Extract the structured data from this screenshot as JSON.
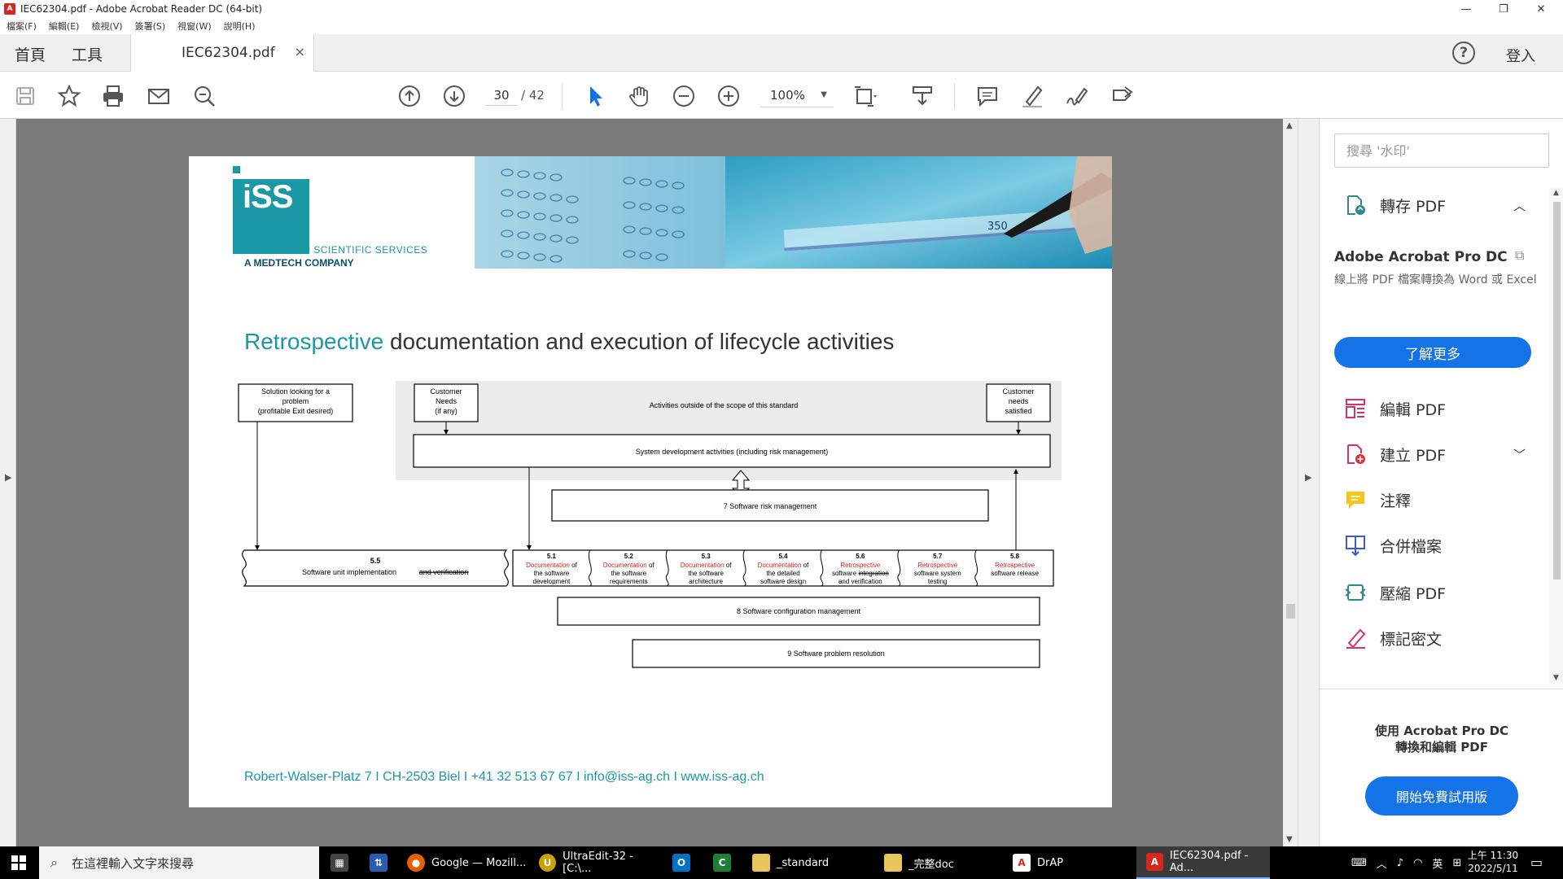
{
  "window": {
    "title": "IEC62304.pdf - Adobe Acrobat Reader DC (64-bit)",
    "minimize": "—",
    "restore": "❐",
    "close": "✕"
  },
  "menu": [
    "檔案(F)",
    "編輯(E)",
    "檢視(V)",
    "簽署(S)",
    "視窗(W)",
    "說明(H)"
  ],
  "tabs": {
    "home": "首頁",
    "tools": "工具",
    "document": "IEC62304.pdf",
    "close": "×",
    "help": "?",
    "login": "登入"
  },
  "toolbar": {
    "page_current": "30",
    "page_total": "/ 42",
    "zoom": "100%",
    "zoom_caret": "▼",
    "icons": [
      "save-icon",
      "bookmark-star-icon",
      "print-icon",
      "email-icon",
      "zoom-search-icon",
      "page-up-icon",
      "page-down-icon",
      "select-cursor-icon",
      "hand-tool-icon",
      "zoom-out-icon",
      "zoom-in-icon",
      "fit-page-icon",
      "scroll-mode-icon",
      "comment-icon",
      "highlight-pen-icon",
      "sign-icon",
      "share-icon"
    ]
  },
  "pdf_page": {
    "logo_text": "iSS",
    "logo_sub1": "INTEGRATED SCIENTIFIC SERVICES",
    "logo_sub2": "A MEDTECH COMPANY",
    "photo_label": "350",
    "title_highlight": "Retrospective",
    "title_rest": " documentation and execution of lifecycle activities",
    "footer": "Robert-Walser-Platz 7  I  CH-2503 Biel  I    +41 32 513 67 67  I  info@iss-ag.ch  I  www.iss-ag.ch",
    "diagram": {
      "solution": [
        "Solution looking for a",
        "problem",
        "(profitable Exit desired)"
      ],
      "customer_needs": [
        "Customer",
        "Needs",
        "(if any)"
      ],
      "outside_scope": "Activities outside of the scope of this standard",
      "customer_satisfied": [
        "Customer",
        "needs",
        "satisfied"
      ],
      "system_dev": "System development activities (including risk management)",
      "risk_mgmt": "7 Software risk management",
      "unit_impl_num": "5.5",
      "unit_impl_text": "Software unit implementation",
      "unit_impl_struck": "and verification",
      "activities": [
        {
          "num": "5.1",
          "red": "Documentation",
          "black1": " of",
          "line2": "the software",
          "line3": "development"
        },
        {
          "num": "5.2",
          "red": "Documentation",
          "black1": " of",
          "line2": "the software",
          "line3": "requirements"
        },
        {
          "num": "5.3",
          "red": "Documentation",
          "black1": " of",
          "line2": "the software",
          "line3": "architecture"
        },
        {
          "num": "5.4",
          "red": "Documentation",
          "black1": " of",
          "line2": "the detailed",
          "line3": "software design"
        },
        {
          "num": "5.6",
          "red": "Retrospective",
          "black1": "",
          "line2": "software integration",
          "line3": "and verification"
        },
        {
          "num": "5.7",
          "red": "Retrospective",
          "black1": "",
          "line2": "software system",
          "line3": "testing"
        },
        {
          "num": "5.8",
          "red": "Retrospective",
          "black1": "",
          "line2": "software release",
          "line3": ""
        }
      ],
      "config_mgmt": "8 Software configuration management",
      "problem_res": "9 Software problem resolution"
    }
  },
  "right_pane": {
    "search_placeholder": "搜尋 '水印'",
    "export_pdf": "轉存 PDF",
    "promo_title": "Adobe Acrobat Pro DC",
    "promo_copy": "線上將 PDF 檔案轉換為 Word 或 Excel",
    "learn_more": "了解更多",
    "tools": [
      "編輯 PDF",
      "建立 PDF",
      "注釋",
      "合併檔案",
      "壓縮 PDF",
      "標記密文"
    ],
    "cta": [
      "使用 Acrobat Pro DC",
      "轉換和編輯 PDF"
    ],
    "trial": "開始免費試用版"
  },
  "taskbar": {
    "search_placeholder": "在這裡輸入文字來搜尋",
    "apps": [
      {
        "label": "Google — Mozill...",
        "icon": "firefox-icon"
      },
      {
        "label": "UltraEdit-32 - [C:\\...",
        "icon": "ultraedit-icon"
      },
      {
        "label": "_standard",
        "icon": "folder-icon"
      },
      {
        "label": "_完整doc",
        "icon": "folder-icon"
      },
      {
        "label": "DrAP",
        "icon": "acrobat-icon"
      },
      {
        "label": "IEC62304.pdf - Ad...",
        "icon": "acrobat-icon"
      }
    ],
    "ime": "英",
    "time": "上午 11:30",
    "date": "2022/5/11",
    "notifications": "1"
  },
  "colors": {
    "accent_teal": "#1b98a5",
    "acrobat_blue": "#1473e6",
    "red_text": "#e02020",
    "doc_bg": "#7a7a7a"
  }
}
